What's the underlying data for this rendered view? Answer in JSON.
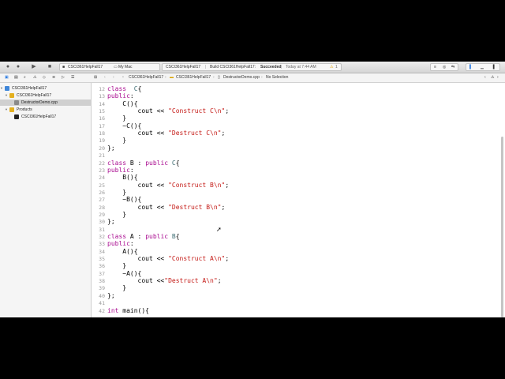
{
  "toolbar": {
    "scheme": "CSCI361HelpFall17",
    "device": "My Mac",
    "status_project": "CSCI361HelpFall17",
    "status_build": "Build CSCI361HelpFall17:",
    "status_result": "Succeeded",
    "status_time": "Today at 7:44 AM",
    "warning_count": "1"
  },
  "jumpbar": {
    "crumb1": "CSCI361HelpFall17",
    "crumb2": "CSCI361HelpFall17",
    "crumb3": "DestructorDemo.cpp",
    "crumb4": "No Selection"
  },
  "navigator": {
    "items": [
      {
        "label": "CSCI361HelpFall17",
        "level": 0,
        "icon": "project-icon"
      },
      {
        "label": "CSCI361HelpFall17",
        "level": 1,
        "icon": "folder-icon"
      },
      {
        "label": "DestructorDemo.cpp",
        "level": 2,
        "icon": "cpp-file-icon",
        "selected": true
      },
      {
        "label": "Products",
        "level": 1,
        "icon": "folder-icon"
      },
      {
        "label": "CSCI361HelpFall17",
        "level": 2,
        "icon": "executable-icon"
      }
    ]
  },
  "editor": {
    "lines": [
      {
        "n": "12",
        "tokens": [
          [
            "kw",
            "class"
          ],
          [
            "",
            "  "
          ],
          [
            "ty",
            "C"
          ],
          [
            "",
            "{"
          ]
        ]
      },
      {
        "n": "13",
        "tokens": [
          [
            "kw",
            "public"
          ],
          [
            "",
            ":"
          ]
        ]
      },
      {
        "n": "14",
        "tokens": [
          [
            "",
            "    C(){"
          ]
        ]
      },
      {
        "n": "15",
        "tokens": [
          [
            "",
            "        cout << "
          ],
          [
            "str",
            "\"Construct C\\n\""
          ],
          [
            "",
            ";"
          ]
        ]
      },
      {
        "n": "16",
        "tokens": [
          [
            "",
            "    }"
          ]
        ]
      },
      {
        "n": "17",
        "tokens": [
          [
            "",
            "    ~C(){"
          ]
        ]
      },
      {
        "n": "18",
        "tokens": [
          [
            "",
            "        cout << "
          ],
          [
            "str",
            "\"Destruct C\\n\""
          ],
          [
            "",
            ";"
          ]
        ]
      },
      {
        "n": "19",
        "tokens": [
          [
            "",
            "    }"
          ]
        ]
      },
      {
        "n": "20",
        "tokens": [
          [
            "",
            "};"
          ]
        ]
      },
      {
        "n": "21",
        "tokens": [
          [
            "",
            ""
          ]
        ]
      },
      {
        "n": "22",
        "tokens": [
          [
            "kw",
            "class"
          ],
          [
            "",
            " B : "
          ],
          [
            "kw",
            "public"
          ],
          [
            "",
            " "
          ],
          [
            "ty",
            "C"
          ],
          [
            "",
            "{"
          ]
        ]
      },
      {
        "n": "23",
        "tokens": [
          [
            "kw",
            "public"
          ],
          [
            "",
            ":"
          ]
        ]
      },
      {
        "n": "24",
        "tokens": [
          [
            "",
            "    B(){"
          ]
        ]
      },
      {
        "n": "25",
        "tokens": [
          [
            "",
            "        cout << "
          ],
          [
            "str",
            "\"Construct B\\n\""
          ],
          [
            "",
            ";"
          ]
        ]
      },
      {
        "n": "26",
        "tokens": [
          [
            "",
            "    }"
          ]
        ]
      },
      {
        "n": "27",
        "tokens": [
          [
            "",
            "    ~B(){"
          ]
        ]
      },
      {
        "n": "28",
        "tokens": [
          [
            "",
            "        cout << "
          ],
          [
            "str",
            "\"Destruct B\\n\""
          ],
          [
            "",
            ";"
          ]
        ]
      },
      {
        "n": "29",
        "tokens": [
          [
            "",
            "    }"
          ]
        ]
      },
      {
        "n": "30",
        "tokens": [
          [
            "",
            "};"
          ]
        ]
      },
      {
        "n": "31",
        "tokens": [
          [
            "",
            ""
          ]
        ]
      },
      {
        "n": "32",
        "tokens": [
          [
            "kw",
            "class"
          ],
          [
            "",
            " A : "
          ],
          [
            "kw",
            "public"
          ],
          [
            "",
            " "
          ],
          [
            "ty",
            "B"
          ],
          [
            "",
            "{"
          ]
        ]
      },
      {
        "n": "33",
        "tokens": [
          [
            "kw",
            "public"
          ],
          [
            "",
            ":"
          ]
        ]
      },
      {
        "n": "34",
        "tokens": [
          [
            "",
            "    A(){"
          ]
        ]
      },
      {
        "n": "35",
        "tokens": [
          [
            "",
            "        cout << "
          ],
          [
            "str",
            "\"Construct A\\n\""
          ],
          [
            "",
            ";"
          ]
        ]
      },
      {
        "n": "36",
        "tokens": [
          [
            "",
            "    }"
          ]
        ]
      },
      {
        "n": "37",
        "tokens": [
          [
            "",
            "    ~A(){"
          ]
        ]
      },
      {
        "n": "38",
        "tokens": [
          [
            "",
            "        cout <<"
          ],
          [
            "str",
            "\"Destruct A\\n\""
          ],
          [
            "",
            ";"
          ]
        ]
      },
      {
        "n": "39",
        "tokens": [
          [
            "",
            "    }"
          ]
        ]
      },
      {
        "n": "40",
        "tokens": [
          [
            "",
            "};"
          ]
        ]
      },
      {
        "n": "41",
        "tokens": [
          [
            "",
            ""
          ]
        ]
      },
      {
        "n": "42",
        "tokens": [
          [
            "kw",
            "int"
          ],
          [
            "",
            " main(){"
          ]
        ]
      }
    ]
  }
}
